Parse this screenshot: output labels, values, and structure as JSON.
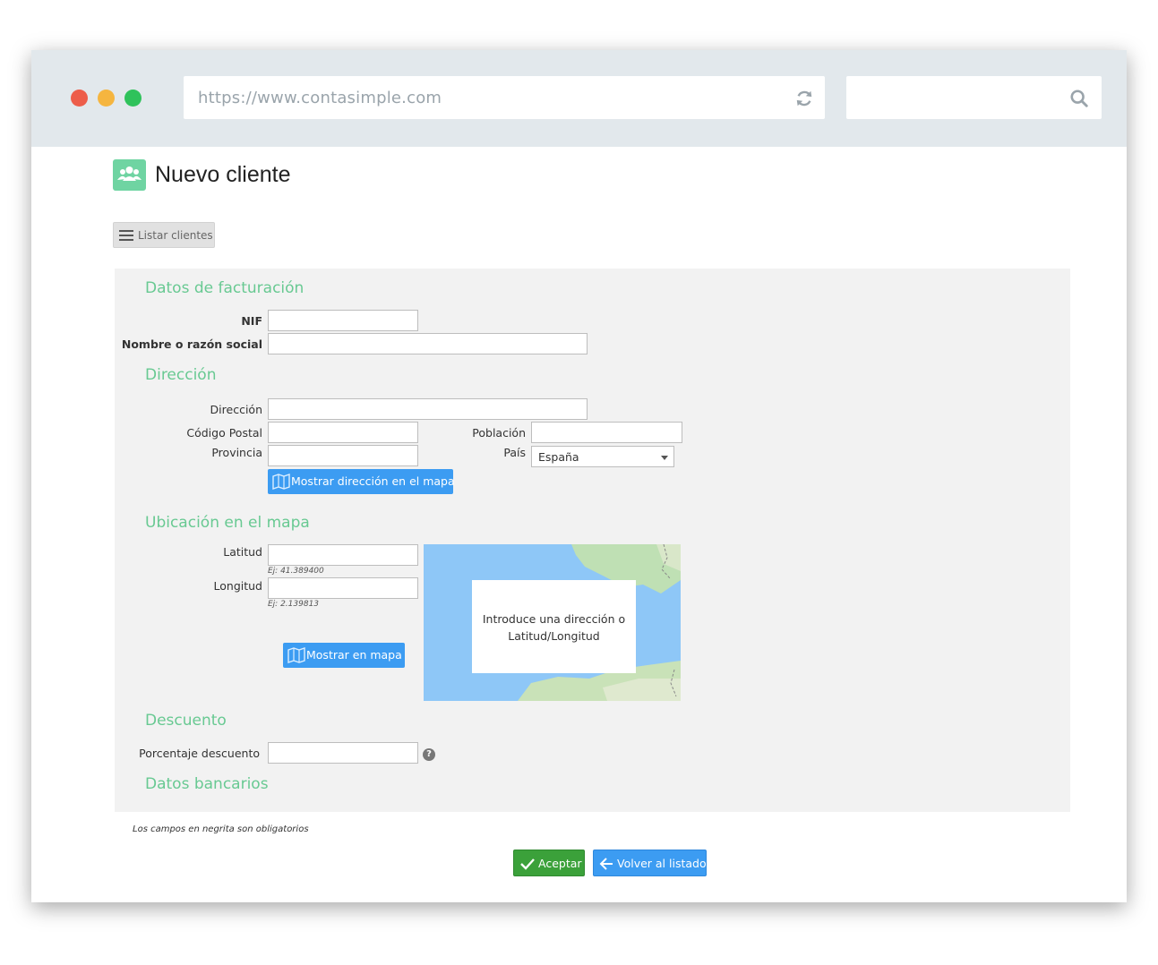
{
  "browser": {
    "url": "https://www.contasimple.com",
    "search_value": ""
  },
  "page": {
    "title": "Nuevo cliente",
    "list_button": "Listar clientes"
  },
  "billing": {
    "heading": "Datos de facturación",
    "nif_label": "NIF",
    "name_label": "Nombre o razón social"
  },
  "address": {
    "heading": "Dirección",
    "address_label": "Dirección",
    "postal_label": "Código Postal",
    "province_label": "Provincia",
    "city_label": "Población",
    "country_label": "País",
    "country_value": "España",
    "show_map_button": "Mostrar dirección en el mapa"
  },
  "location": {
    "heading": "Ubicación en el mapa",
    "lat_label": "Latitud",
    "lat_hint": "Ej: 41.389400",
    "lng_label": "Longitud",
    "lng_hint": "Ej: 2.139813",
    "show_button": "Mostrar en mapa",
    "map_message": "Introduce una dirección o Latitud/Longitud"
  },
  "discount": {
    "heading": "Descuento",
    "percent_label": "Porcentaje descuento",
    "help": "?"
  },
  "bank": {
    "heading": "Datos bancarios"
  },
  "footer": {
    "required_note": "Los campos en negrita son obligatorios",
    "accept_button": "Aceptar",
    "back_button": "Volver al listado"
  },
  "colors": {
    "accent_green": "#68c992",
    "button_blue": "#3c9cf2",
    "accept_green": "#3ba13a"
  }
}
